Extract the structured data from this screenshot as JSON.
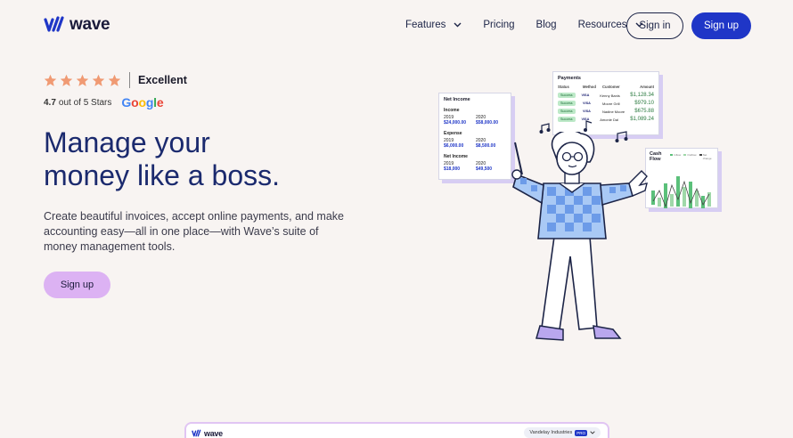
{
  "brand": {
    "name": "wave",
    "color": "#1f36c7"
  },
  "nav": {
    "items": [
      {
        "label": "Features",
        "has_dropdown": true
      },
      {
        "label": "Pricing",
        "has_dropdown": false
      },
      {
        "label": "Blog",
        "has_dropdown": false
      },
      {
        "label": "Resources",
        "has_dropdown": true
      }
    ],
    "sign_in": "Sign in",
    "sign_up": "Sign up"
  },
  "rating": {
    "stars": 5,
    "label": "Excellent",
    "score": "4.7",
    "out_of": "out of 5 Stars",
    "provider": "Google",
    "star_color": "#f09a73"
  },
  "hero": {
    "headline_line1": "Manage your",
    "headline_line2": "money like a boss.",
    "subtext": "Create beautiful invoices, accept online payments, and make accounting easy—all in one place—with Wave’s suite of money management tools.",
    "cta": "Sign up"
  },
  "illustration": {
    "net_income_card": {
      "title": "Net Income",
      "sections": [
        {
          "label": "Income",
          "cols": [
            {
              "year": "2019",
              "amount": "$24,000.00"
            },
            {
              "year": "2020",
              "amount": "$58,000.00"
            }
          ]
        },
        {
          "label": "Expense",
          "cols": [
            {
              "year": "2019",
              "amount": "$6,000.00"
            },
            {
              "year": "2020",
              "amount": "$8,500.00"
            }
          ]
        },
        {
          "label": "Net Income",
          "cols": [
            {
              "year": "2019",
              "amount": "$18,000"
            },
            {
              "year": "2020",
              "amount": "$49,500"
            }
          ]
        }
      ]
    },
    "payments_card": {
      "title": "Payments",
      "headers": [
        "Status",
        "Method",
        "Customer",
        "Amount"
      ],
      "rows": [
        {
          "status": "Success",
          "method": "VISA",
          "customer": "Kenny Banis",
          "amount": "$1,128.34"
        },
        {
          "status": "Success",
          "method": "VISA",
          "customer": "Moore Grill",
          "amount": "$979.10"
        },
        {
          "status": "Success",
          "method": "VISA",
          "customer": "Nadine Moore",
          "amount": "$675.88"
        },
        {
          "status": "Success",
          "method": "VISA",
          "customer": "Amonie Dal",
          "amount": "$1,089.24"
        }
      ]
    },
    "cashflow_card": {
      "title": "Cash Flow",
      "legend": [
        "Inflow",
        "Outflow",
        "Net change"
      ]
    }
  },
  "preview": {
    "logo_text": "wave",
    "org_name": "Vandelay Industries",
    "org_badge": "PRO"
  }
}
